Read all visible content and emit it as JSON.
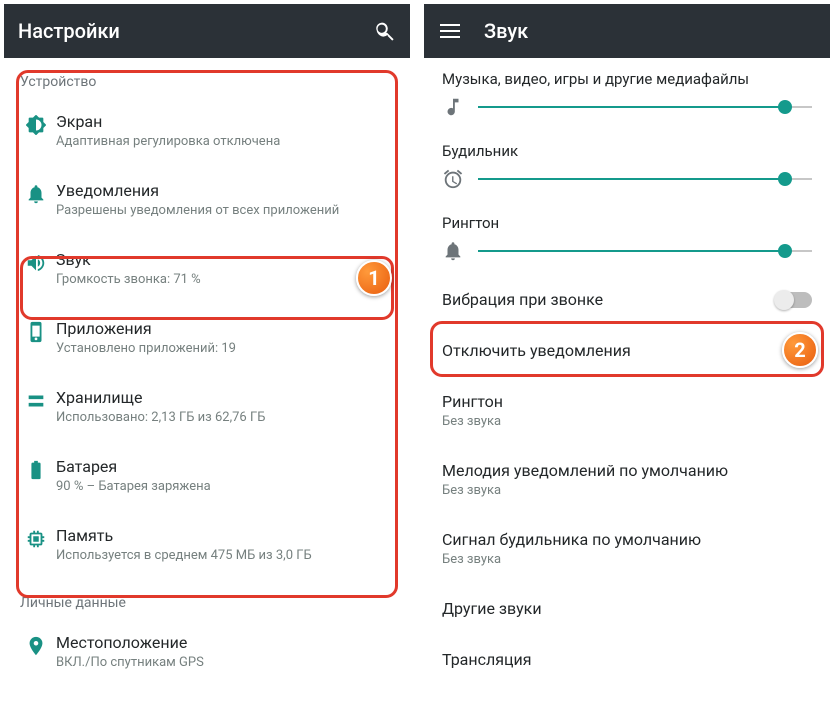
{
  "left": {
    "header_title": "Настройки",
    "section_device": "Устройство",
    "items": {
      "display": {
        "title": "Экран",
        "subtitle": "Адаптивная регулировка отключена"
      },
      "notifications": {
        "title": "Уведомления",
        "subtitle": "Разрешены уведомления от всех приложений"
      },
      "sound": {
        "title": "Звук",
        "subtitle": "Громкость звонка: 71 %"
      },
      "apps": {
        "title": "Приложения",
        "subtitle": "Установлено приложений: 19"
      },
      "storage": {
        "title": "Хранилище",
        "subtitle": "Использовано: 2,13 ГБ из 62,76 ГБ"
      },
      "battery": {
        "title": "Батарея",
        "subtitle": "90 % – Батарея заряжена"
      },
      "memory": {
        "title": "Память",
        "subtitle": "Используется в среднем 475 МБ из 3,0 ГБ"
      }
    },
    "section_personal": "Личные данные",
    "location": {
      "title": "Местоположение",
      "subtitle": "ВКЛ./По спутникам GPS"
    }
  },
  "right": {
    "header_title": "Звук",
    "sliders": {
      "media": {
        "label": "Музыка, видео, игры и другие медиафайлы",
        "percent": 92
      },
      "alarm": {
        "label": "Будильник",
        "percent": 92
      },
      "ring": {
        "label": "Рингтон",
        "percent": 92
      }
    },
    "vibrate": {
      "title": "Вибрация при звонке"
    },
    "mute_notifications": {
      "title": "Отключить уведомления"
    },
    "ringtone": {
      "title": "Рингтон",
      "subtitle": "Без звука"
    },
    "default_notif": {
      "title": "Мелодия уведомлений по умолчанию",
      "subtitle": "Без звука"
    },
    "default_alarm": {
      "title": "Сигнал будильника по умолчанию",
      "subtitle": "Без звука"
    },
    "other_sounds": {
      "title": "Другие звуки"
    },
    "cast": {
      "title": "Трансляция"
    }
  },
  "badges": {
    "one": "1",
    "two": "2"
  }
}
